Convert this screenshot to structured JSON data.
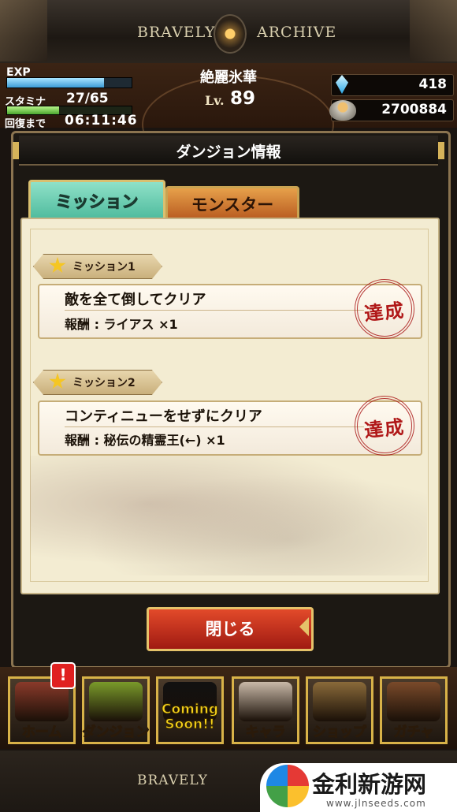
{
  "top_banner": {
    "left_text": "BRAVELY",
    "right_text": "ARCHIVE"
  },
  "status": {
    "exp_label": "EXP",
    "exp_fraction": 0.78,
    "stamina_label": "スタミナ",
    "stamina_value": "27/65",
    "stamina_fraction": 0.415,
    "recover_label": "回復まで",
    "recover_time": "06:11:46",
    "player_name": "絶麗氷華",
    "level_label": "Lv.",
    "level_value": "89",
    "crystals": "418",
    "gil": "2700884"
  },
  "dialog": {
    "title": "ダンジョン情報",
    "tabs": [
      {
        "label": "ミッション",
        "active": true
      },
      {
        "label": "モンスター",
        "active": false
      }
    ],
    "missions": [
      {
        "ribbon": "ミッション1",
        "description": "敵を全て倒してクリア",
        "reward": "報酬 : ライアス ×1",
        "stamp": "達成"
      },
      {
        "ribbon": "ミッション2",
        "description": "コンティニューをせずにクリア",
        "reward": "報酬 : 秘伝の精霊王(←) ×1",
        "stamp": "達成"
      }
    ],
    "close_label": "閉じる"
  },
  "nav": {
    "items": [
      {
        "label": "ホーム",
        "art_color": "#8a3a2a"
      },
      {
        "label": "ダンジョン",
        "art_color": "#7a9a2a"
      },
      {
        "label": "Coming Soon!!",
        "art_color": "#111111"
      },
      {
        "label": "キャラ",
        "art_color": "#c9b9a8"
      },
      {
        "label": "ショップ",
        "art_color": "#8a6a3a"
      },
      {
        "label": "ガチャ",
        "art_color": "#7a4a2a"
      }
    ],
    "alert": "!"
  },
  "bottom_banner": {
    "text": "BRAVELY"
  },
  "site_logo": {
    "name": "金利新游网",
    "url": "www.jlnseeds.com"
  }
}
